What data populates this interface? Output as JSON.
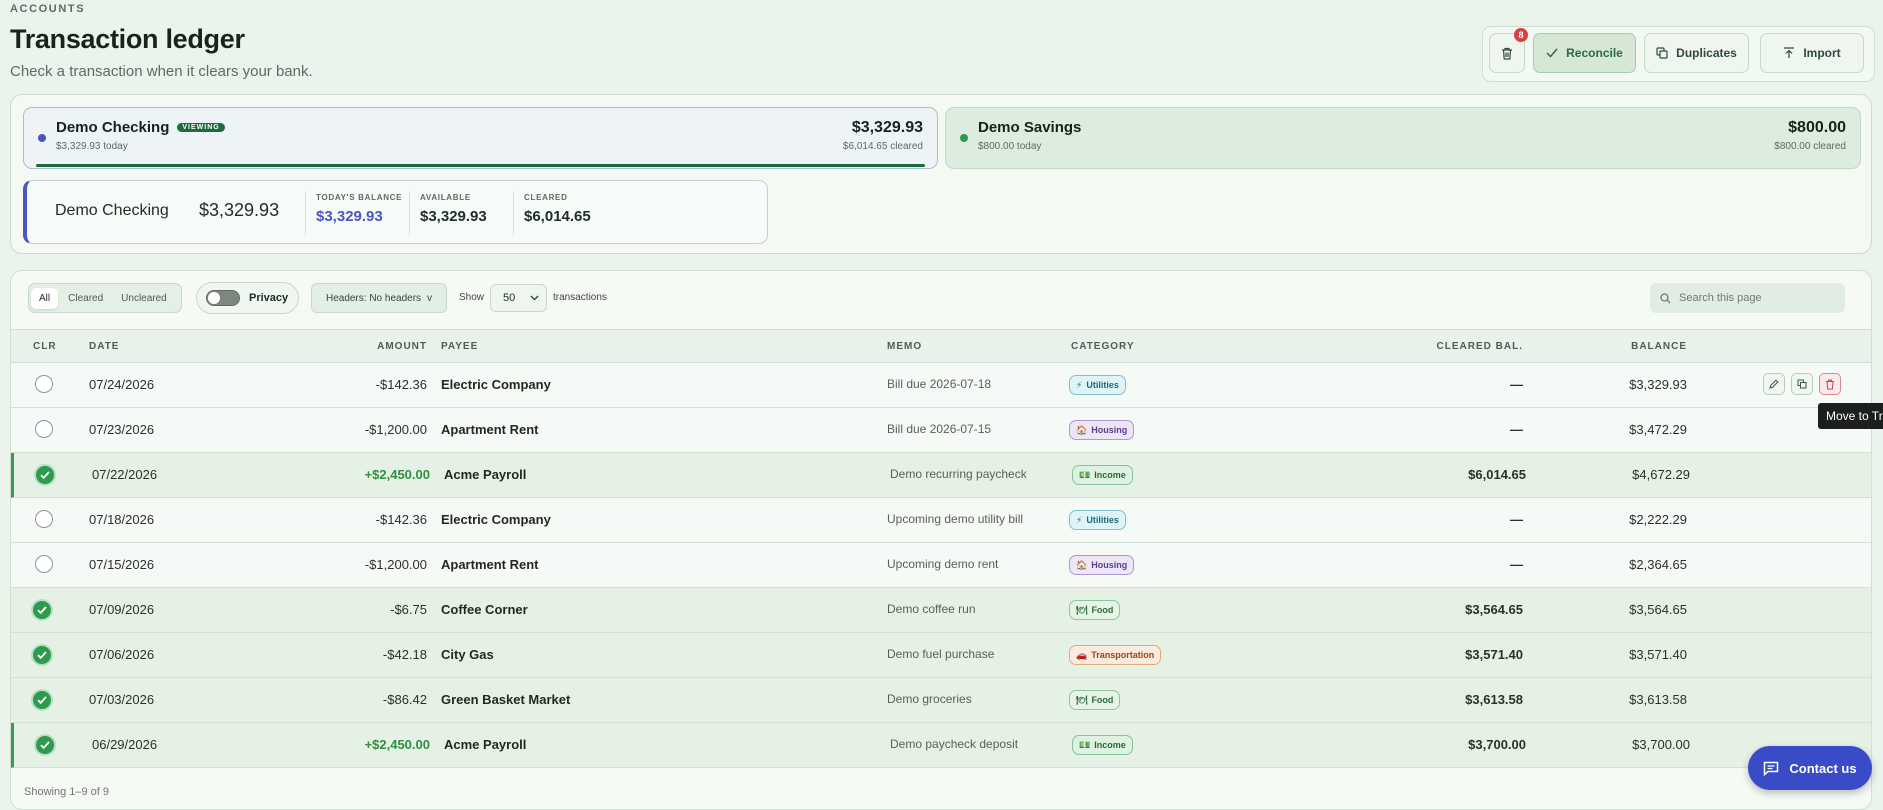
{
  "header": {
    "eyebrow": "ACCOUNTS",
    "title": "Transaction ledger",
    "subtitle": "Check a transaction when it clears your bank."
  },
  "actions": {
    "trash_count": "8",
    "reconcile": "Reconcile",
    "duplicates": "Duplicates",
    "import": "Import"
  },
  "accounts": [
    {
      "name": "Demo Checking",
      "badge": "VIEWING",
      "today": "$3,329.93 today",
      "amount": "$3,329.93",
      "cleared": "$6,014.65 cleared",
      "dot_color": "#4b55c0"
    },
    {
      "name": "Demo Savings",
      "today": "$800.00 today",
      "amount": "$800.00",
      "cleared": "$800.00 cleared",
      "dot_color": "#2f9a4d"
    }
  ],
  "balance_card": {
    "name": "Demo Checking",
    "total": "$3,329.93",
    "todays_label": "TODAY'S BALANCE",
    "todays_value": "$3,329.93",
    "available_label": "AVAILABLE",
    "available_value": "$3,329.93",
    "cleared_label": "CLEARED",
    "cleared_value": "$6,014.65"
  },
  "toolbar": {
    "filters": [
      "All",
      "Cleared",
      "Uncleared"
    ],
    "active_filter": "All",
    "privacy_label": "Privacy",
    "headers_label": "Headers: No headers",
    "show_label": "Show",
    "show_value": "50",
    "transactions_label": "transactions",
    "search_placeholder": "Search this page"
  },
  "columns": {
    "clr": "CLR",
    "date": "DATE",
    "amount": "AMOUNT",
    "payee": "PAYEE",
    "memo": "MEMO",
    "category": "CATEGORY",
    "cleared_bal": "CLEARED BAL.",
    "balance": "BALANCE"
  },
  "rows": [
    {
      "cleared": false,
      "date": "07/24/2026",
      "amount": "-$142.36",
      "positive": false,
      "payee": "Electric Company",
      "memo": "Bill due 2026-07-18",
      "category": "Utilities",
      "cat_class": "utilities",
      "cat_icon": "⚡",
      "cleared_bal": "—",
      "balance": "$3,329.93"
    },
    {
      "cleared": false,
      "date": "07/23/2026",
      "amount": "-$1,200.00",
      "positive": false,
      "payee": "Apartment Rent",
      "memo": "Bill due 2026-07-15",
      "category": "Housing",
      "cat_class": "housing",
      "cat_icon": "🏠",
      "cleared_bal": "—",
      "balance": "$3,472.29"
    },
    {
      "cleared": true,
      "date": "07/22/2026",
      "amount": "+$2,450.00",
      "positive": true,
      "payee": "Acme Payroll",
      "memo": "Demo recurring paycheck",
      "category": "Income",
      "cat_class": "income",
      "cat_icon": "💵",
      "cleared_bal": "$6,014.65",
      "balance": "$4,672.29"
    },
    {
      "cleared": false,
      "date": "07/18/2026",
      "amount": "-$142.36",
      "positive": false,
      "payee": "Electric Company",
      "memo": "Upcoming demo utility bill",
      "category": "Utilities",
      "cat_class": "utilities",
      "cat_icon": "⚡",
      "cleared_bal": "—",
      "balance": "$2,222.29"
    },
    {
      "cleared": false,
      "date": "07/15/2026",
      "amount": "-$1,200.00",
      "positive": false,
      "payee": "Apartment Rent",
      "memo": "Upcoming demo rent",
      "category": "Housing",
      "cat_class": "housing",
      "cat_icon": "🏠",
      "cleared_bal": "—",
      "balance": "$2,364.65"
    },
    {
      "cleared": true,
      "date": "07/09/2026",
      "amount": "-$6.75",
      "positive": false,
      "payee": "Coffee Corner",
      "memo": "Demo coffee run",
      "category": "Food",
      "cat_class": "food",
      "cat_icon": "🍽",
      "cleared_bal": "$3,564.65",
      "balance": "$3,564.65"
    },
    {
      "cleared": true,
      "date": "07/06/2026",
      "amount": "-$42.18",
      "positive": false,
      "payee": "City Gas",
      "memo": "Demo fuel purchase",
      "category": "Transportation",
      "cat_class": "transportation",
      "cat_icon": "🚗",
      "cleared_bal": "$3,571.40",
      "balance": "$3,571.40"
    },
    {
      "cleared": true,
      "date": "07/03/2026",
      "amount": "-$86.42",
      "positive": false,
      "payee": "Green Basket Market",
      "memo": "Demo groceries",
      "category": "Food",
      "cat_class": "food",
      "cat_icon": "🍽",
      "cleared_bal": "$3,613.58",
      "balance": "$3,613.58"
    },
    {
      "cleared": true,
      "date": "06/29/2026",
      "amount": "+$2,450.00",
      "positive": true,
      "payee": "Acme Payroll",
      "memo": "Demo paycheck deposit",
      "category": "Income",
      "cat_class": "income",
      "cat_icon": "💵",
      "cleared_bal": "$3,700.00",
      "balance": "$3,700.00"
    }
  ],
  "tooltip": "Move to Tr",
  "footer_text": "Showing 1–9 of 9",
  "contact_label": "Contact us"
}
